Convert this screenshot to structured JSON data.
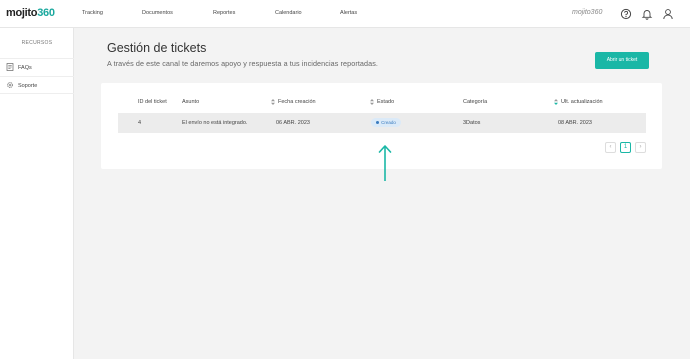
{
  "header": {
    "logo_main": "mojito",
    "logo_accent": "360",
    "nav": [
      "Tracking",
      "Documentos",
      "Reportes",
      "Calendario",
      "Alertas"
    ],
    "brand_small": "mojito360",
    "icons": [
      "help-icon",
      "bell-icon",
      "user-icon"
    ]
  },
  "sidebar": {
    "heading": "RECURSOS",
    "items": [
      {
        "label": "FAQs",
        "icon": "document-icon"
      },
      {
        "label": "Soporte",
        "icon": "gear-icon"
      }
    ]
  },
  "main": {
    "title": "Gestión de tickets",
    "subtitle": "A través de este canal te daremos apoyo y respuesta a tus incidencias reportadas.",
    "open_ticket_label": "Abrir un ticket"
  },
  "table": {
    "columns": [
      "ID del ticket",
      "Asunto",
      "Fecha creación",
      "Estado",
      "Categoría",
      "Ult. actualización"
    ],
    "rows": [
      {
        "id": "4",
        "subject": "El envío no está integrado.",
        "created": "06 ABR. 2023",
        "status": "Creado",
        "category": "3Datos",
        "updated": "08 ABR. 2023"
      }
    ]
  },
  "pagination": {
    "prev": "‹",
    "page": "1",
    "next": "›"
  },
  "colors": {
    "accent": "#1ab7a6",
    "status_bg": "#dbeaf8",
    "status_text": "#3a7bbf"
  }
}
